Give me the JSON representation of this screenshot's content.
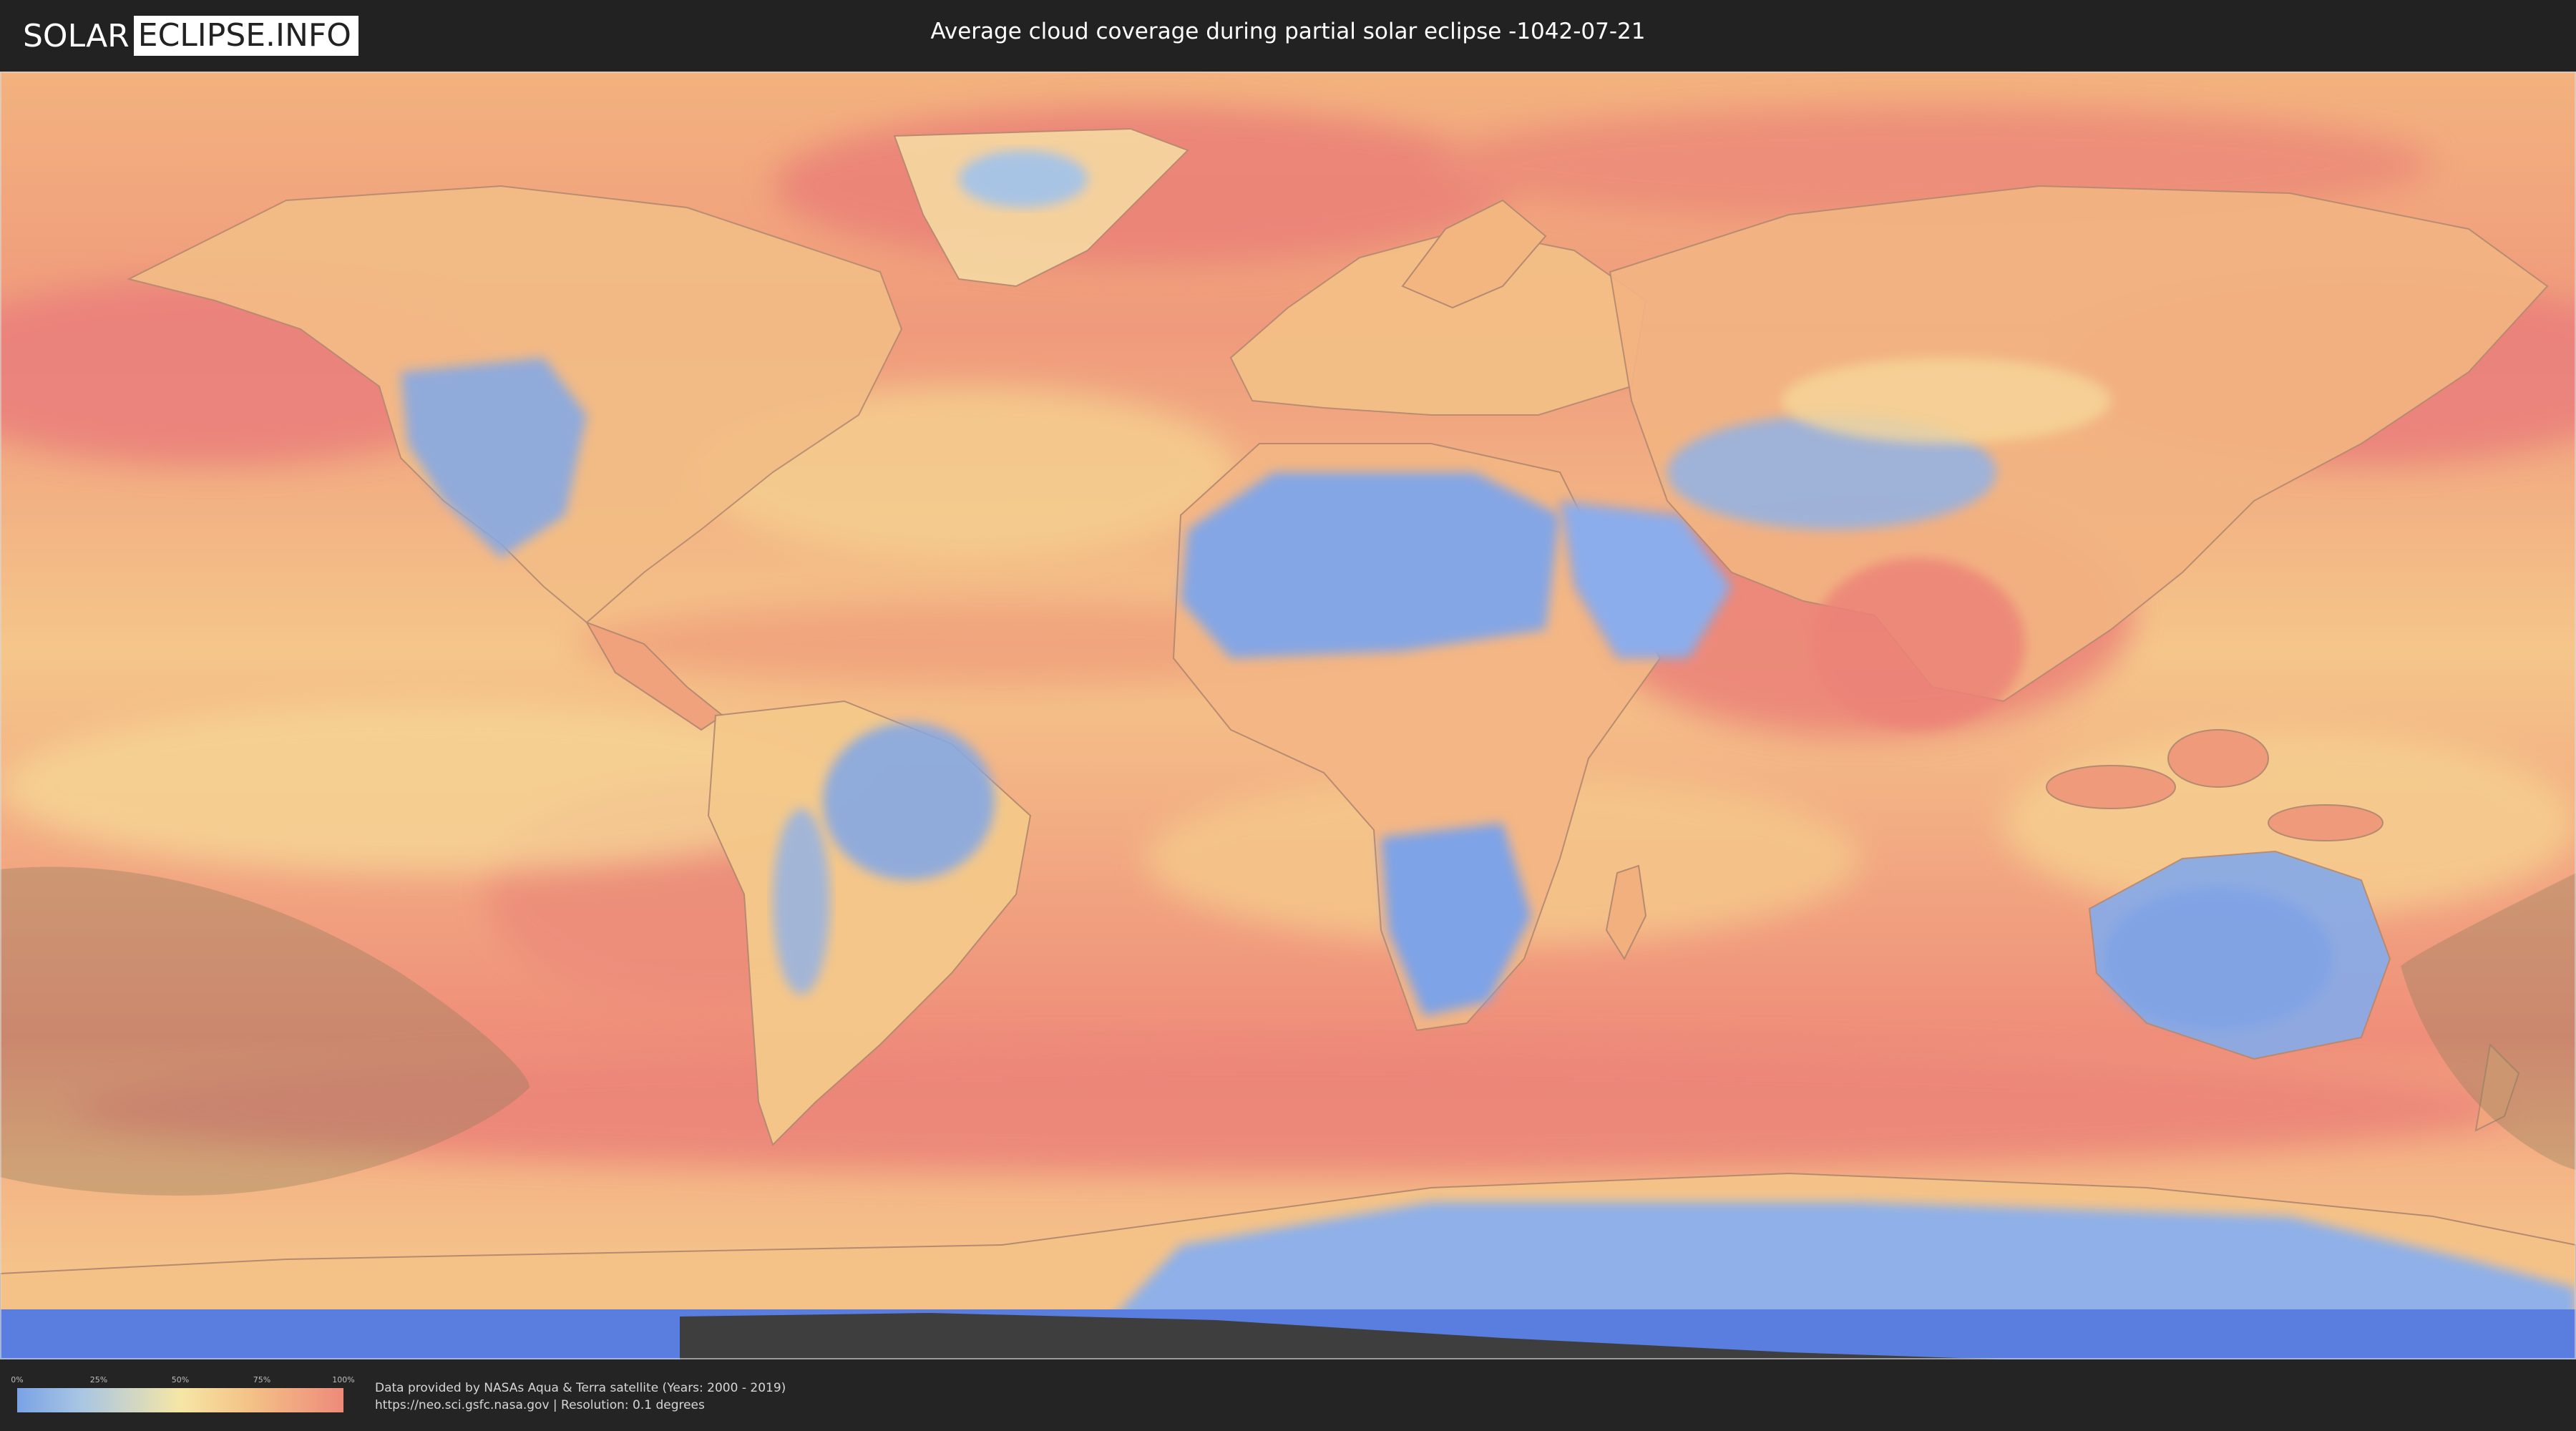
{
  "header": {
    "logo_part1": "SOLAR",
    "logo_part2": "ECLIPSE.INFO",
    "title": "Average cloud coverage during partial solar eclipse -1042-07-21"
  },
  "map": {
    "description_icon": "world-map-icon",
    "eclipse_shadow_color": "#8a7a5a"
  },
  "legend": {
    "ticks": [
      "0%",
      "25%",
      "50%",
      "75%",
      "100%"
    ],
    "colors": [
      "#7aa3e6",
      "#a9c6e3",
      "#f6e6a6",
      "#f4c487",
      "#ee8a7a"
    ]
  },
  "footer": {
    "credit_line1": "Data provided by NASAs Aqua & Terra satellite (Years: 2000 - 2019)",
    "credit_line2": "https://neo.sci.gsfc.nasa.gov | Resolution: 0.1 degrees"
  }
}
